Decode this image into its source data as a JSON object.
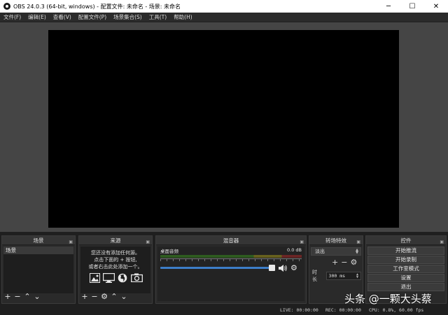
{
  "window": {
    "title": "OBS 24.0.3 (64-bit, windows) - 配置文件: 未命名 - 场景: 未命名",
    "minimize_glyph": "─",
    "maximize_glyph": "☐",
    "close_glyph": "✕"
  },
  "menu": [
    "文件(F)",
    "编辑(E)",
    "查看(V)",
    "配置文件(P)",
    "场景集合(S)",
    "工具(T)",
    "帮助(H)"
  ],
  "docks": {
    "scenes": {
      "title": "场景",
      "items": [
        "场景"
      ]
    },
    "sources": {
      "title": "来源",
      "hint_lines": [
        "您还没有添加任何源。",
        "点击下面的 + 按钮,",
        "或者右击此处添加一个。"
      ]
    },
    "mixer": {
      "title": "混音器",
      "channel_name": "桌面音频",
      "db_value": "0.0 dB",
      "volume_percent": 100
    },
    "transitions": {
      "title": "转场特效",
      "selected": "淡出",
      "duration_label": "时长",
      "duration_value": "300 ms"
    },
    "controls": {
      "title": "控件",
      "buttons": [
        "开始推流",
        "开始录制",
        "工作室模式",
        "设置",
        "退出"
      ]
    }
  },
  "glyphs": {
    "add": "+",
    "remove": "−",
    "up": "⌃",
    "down": "⌄",
    "gear": "⚙",
    "float": "▣"
  },
  "status": {
    "live": "LIVE: 00:00:00",
    "rec": "REC: 00:00:00",
    "cpu": "CPU: 0.8%, 60.00 fps"
  },
  "watermark": "头条 @一颗大头蔡",
  "colors": {
    "slider": "#3d7ec8",
    "canvas": "#000000",
    "dock": "#2a2a2a"
  }
}
